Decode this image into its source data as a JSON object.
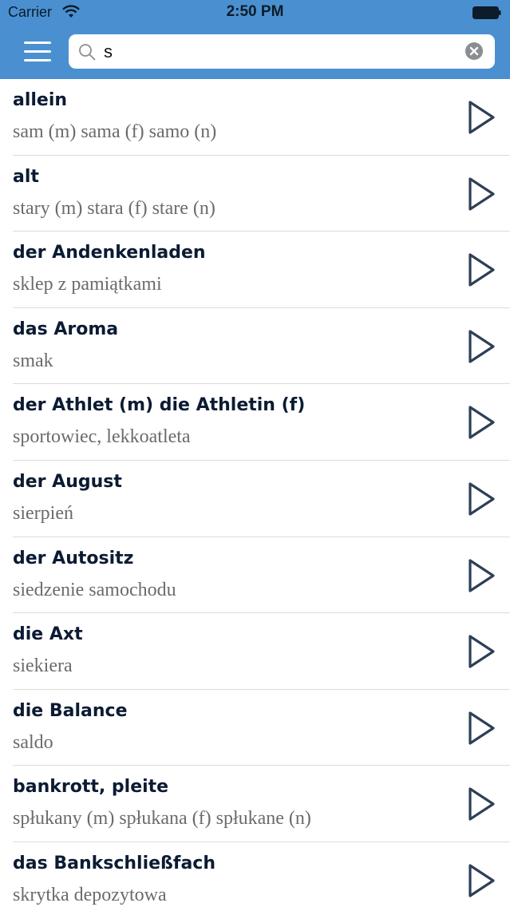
{
  "status_bar": {
    "carrier": "Carrier",
    "time": "2:50 PM"
  },
  "search": {
    "value": "s",
    "placeholder": ""
  },
  "colors": {
    "header": "#4a90d0",
    "term": "#0b1b33",
    "translation": "#6b6b6b",
    "play_icon": "#2e3f57"
  },
  "icons": {
    "menu": "hamburger-menu-icon",
    "search": "magnifier-icon",
    "clear": "clear-x-icon",
    "play": "play-triangle-icon"
  },
  "entries": [
    {
      "term": "allein",
      "translation": "sam (m)  sama (f)  samo (n)"
    },
    {
      "term": "alt",
      "translation": "stary (m)  stara (f)  stare (n)"
    },
    {
      "term": "der Andenkenladen",
      "translation": "sklep z pamiątkami"
    },
    {
      "term": "das Aroma",
      "translation": "smak"
    },
    {
      "term": "der Athlet (m)  die Athletin (f)",
      "translation": "sportowiec, lekkoatleta"
    },
    {
      "term": "der August",
      "translation": "sierpień"
    },
    {
      "term": "der Autositz",
      "translation": "siedzenie samochodu"
    },
    {
      "term": "die Axt",
      "translation": "siekiera"
    },
    {
      "term": "die Balance",
      "translation": "saldo"
    },
    {
      "term": "bankrott, pleite",
      "translation": "spłukany (m)  spłukana (f)  spłukane (n)"
    },
    {
      "term": "das Bankschließfach",
      "translation": "skrytka depozytowa"
    }
  ]
}
